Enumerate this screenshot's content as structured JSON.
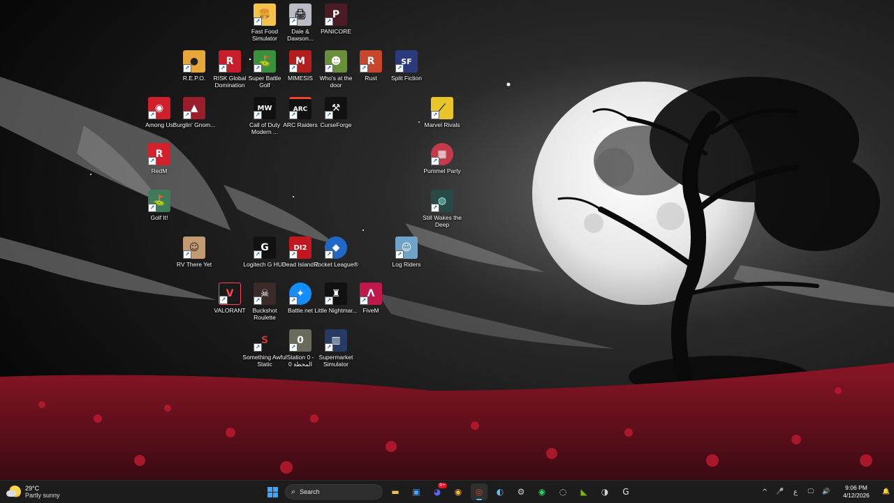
{
  "desktop": {
    "icons": [
      {
        "label": "Fast Food Simulator",
        "glyph": "🍔",
        "bg": "#f3c34a"
      },
      {
        "label": "Dale & Dawson...",
        "glyph": "🖨",
        "bg": "#b9bcc4"
      },
      {
        "label": "PANICORE",
        "glyph": "P",
        "bg": "#4a1b25"
      },
      {
        "label": "R.E.P.O.",
        "glyph": "●",
        "bg": "#e8a73a"
      },
      {
        "label": "RISK Global Domination",
        "glyph": "R",
        "bg": "#c81e2b"
      },
      {
        "label": "Super Battle Golf",
        "glyph": "⛳",
        "bg": "#3c8f3c"
      },
      {
        "label": "MIMESIS",
        "glyph": "M",
        "bg": "#b31f1f"
      },
      {
        "label": "Who's at the door",
        "glyph": "☻",
        "bg": "#6a8f3a"
      },
      {
        "label": "Rust",
        "glyph": "R",
        "bg": "#c6472b"
      },
      {
        "label": "Split Fiction",
        "glyph": "SF",
        "bg": "#2a3a7a"
      },
      {
        "label": "Among Us",
        "glyph": "◉",
        "bg": "#d01f2c"
      },
      {
        "label": "Burglin' Gnom...",
        "glyph": "▲",
        "bg": "#9a1d2a"
      },
      {
        "label": "Call of Duty Modern ...",
        "glyph": "MW",
        "bg": "#101010"
      },
      {
        "label": "ARC Raiders",
        "glyph": "ARC",
        "bg": "#111111"
      },
      {
        "label": "CurseForge",
        "glyph": "⚒",
        "bg": "#111111"
      },
      {
        "label": "Marvel Rivals",
        "glyph": "⟋",
        "bg": "#e8c62a"
      },
      {
        "label": "RedM",
        "glyph": "R",
        "bg": "#d3202a"
      },
      {
        "label": "Pummel Party",
        "glyph": "▦",
        "bg": "#c43a4a"
      },
      {
        "label": "Golf It!",
        "glyph": "⛳",
        "bg": "#3f7a5a"
      },
      {
        "label": "Still Wakes the Deep",
        "glyph": "◍",
        "bg": "#2a4a48"
      },
      {
        "label": "RV There Yet",
        "glyph": "☺",
        "bg": "#c49a72"
      },
      {
        "label": "Logitech G HUB",
        "glyph": "G",
        "bg": "#111111"
      },
      {
        "label": "Dead Island 2",
        "glyph": "DI2",
        "bg": "#c3171f"
      },
      {
        "label": "Rocket League®",
        "glyph": "◆",
        "bg": "#1f68c8"
      },
      {
        "label": "Log Riders",
        "glyph": "☺",
        "bg": "#6fa3c8"
      },
      {
        "label": "VALORANT",
        "glyph": "V",
        "bg": "#1a1a1a"
      },
      {
        "label": "Buckshot Roulette",
        "glyph": "☠",
        "bg": "#3a2a28"
      },
      {
        "label": "Battle.net",
        "glyph": "✦",
        "bg": "#148eff"
      },
      {
        "label": "Little Nightmar...",
        "glyph": "♜",
        "bg": "#101010"
      },
      {
        "label": "FiveM",
        "glyph": "Λ",
        "bg": "#c0184a"
      },
      {
        "label": "Something Awful Static",
        "glyph": "S",
        "bg": "#1a1a1a"
      },
      {
        "label": "Station 0 - المحطة 0",
        "glyph": "0",
        "bg": "#6a6a5a"
      },
      {
        "label": "Supermarket Simulator",
        "glyph": "▥",
        "bg": "#263a63"
      }
    ]
  },
  "taskbar": {
    "weather": {
      "temp": "29°C",
      "condition": "Partly sunny"
    },
    "search": {
      "label": "Search"
    },
    "pinned": [
      {
        "name": "file-explorer",
        "glyph": "▬",
        "color": "#f2c14e"
      },
      {
        "name": "microsoft-store",
        "glyph": "▣",
        "color": "#4aa3ff"
      },
      {
        "name": "discord",
        "glyph": "◕",
        "color": "#5865f2",
        "badge": "9+"
      },
      {
        "name": "app-yellow",
        "glyph": "◉",
        "color": "#f5b82e"
      },
      {
        "name": "chrome",
        "glyph": "◎",
        "color": "#e04a3a",
        "active": true
      },
      {
        "name": "steam",
        "glyph": "◐",
        "color": "#66c0f4"
      },
      {
        "name": "settings",
        "glyph": "⚙",
        "color": "#cfcfcf"
      },
      {
        "name": "spotify",
        "glyph": "◉",
        "color": "#1ed760"
      },
      {
        "name": "circle-app",
        "glyph": "◌",
        "color": "#e8e8e8"
      },
      {
        "name": "nvidia",
        "glyph": "◣",
        "color": "#76b900"
      },
      {
        "name": "rockstar",
        "glyph": "◑",
        "color": "#d6d6d6"
      },
      {
        "name": "logitech-g",
        "glyph": "G",
        "color": "#e8e8e8"
      }
    ],
    "tray": {
      "chevron": "^",
      "mic": "🎤",
      "language": "ع",
      "network": "🖵",
      "volume": "🔊",
      "time": "9:06 PM",
      "date": "4/12/2026",
      "notification": "🔔"
    }
  }
}
